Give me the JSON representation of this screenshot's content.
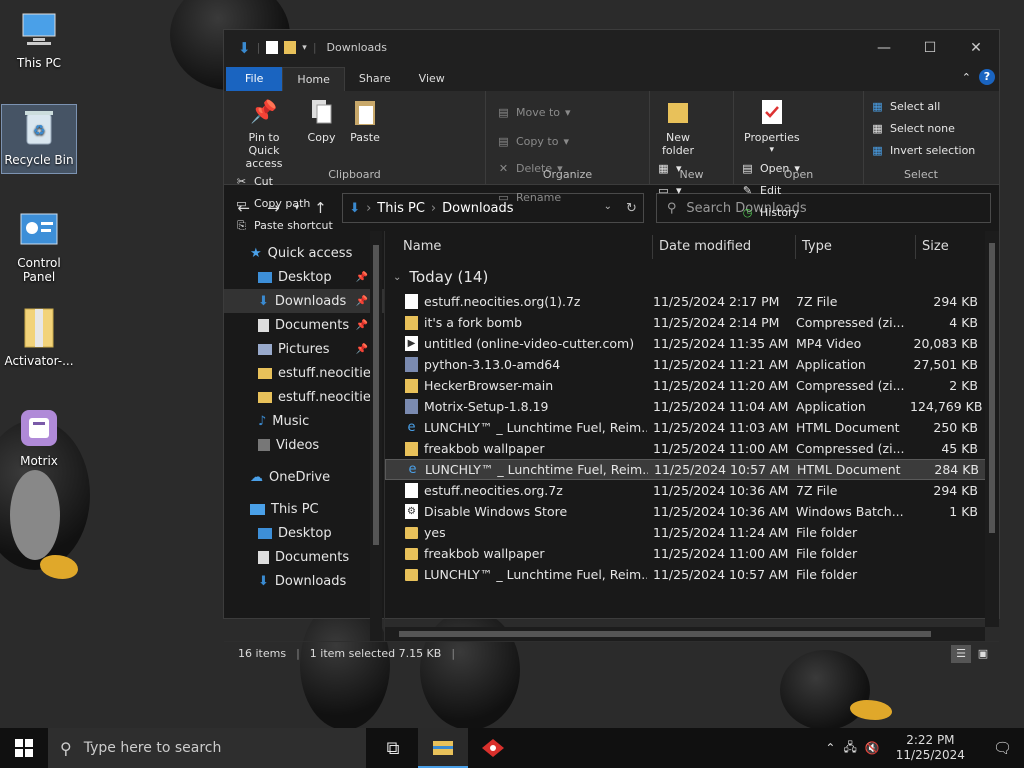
{
  "desktop": {
    "icons": [
      {
        "label": "This PC"
      },
      {
        "label": "Recycle Bin"
      },
      {
        "label": "Control Panel"
      },
      {
        "label": "Activator-..."
      },
      {
        "label": "Motrix"
      }
    ]
  },
  "window": {
    "title": "Downloads",
    "tabs": {
      "file": "File",
      "home": "Home",
      "share": "Share",
      "view": "View"
    },
    "help": "?"
  },
  "ribbon": {
    "clipboard": {
      "name": "Clipboard",
      "pin": "Pin to Quick access",
      "copy": "Copy",
      "paste": "Paste",
      "cut": "Cut",
      "copy_path": "Copy path",
      "paste_shortcut": "Paste shortcut"
    },
    "organize": {
      "name": "Organize",
      "move_to": "Move to",
      "copy_to": "Copy to",
      "delete": "Delete",
      "rename": "Rename"
    },
    "new": {
      "name": "New",
      "new_folder": "New folder"
    },
    "open": {
      "name": "Open",
      "properties": "Properties",
      "open": "Open",
      "edit": "Edit",
      "history": "History"
    },
    "select": {
      "name": "Select",
      "select_all": "Select all",
      "select_none": "Select none",
      "invert": "Invert selection"
    }
  },
  "address": {
    "crumbs": [
      "This PC",
      "Downloads"
    ],
    "search_placeholder": "Search Downloads"
  },
  "nav": {
    "quick_access": "Quick access",
    "items": [
      {
        "label": "Desktop",
        "pinned": true
      },
      {
        "label": "Downloads",
        "pinned": true
      },
      {
        "label": "Documents",
        "pinned": true
      },
      {
        "label": "Pictures",
        "pinned": true
      },
      {
        "label": "estuff.neocities",
        "pinned": false
      },
      {
        "label": "estuff.neocities",
        "pinned": false
      },
      {
        "label": "Music",
        "pinned": false
      },
      {
        "label": "Videos",
        "pinned": false
      }
    ],
    "onedrive": "OneDrive",
    "this_pc": "This PC",
    "pc_items": [
      {
        "label": "Desktop"
      },
      {
        "label": "Documents"
      },
      {
        "label": "Downloads"
      }
    ]
  },
  "columns": {
    "name": "Name",
    "date": "Date modified",
    "type": "Type",
    "size": "Size"
  },
  "group": {
    "label": "Today (14)"
  },
  "files": [
    {
      "name": "estuff.neocities.org(1).7z",
      "date": "11/25/2024 2:17 PM",
      "type": "7Z File",
      "size": "294 KB",
      "icon": "doc"
    },
    {
      "name": "it's a fork bomb",
      "date": "11/25/2024 2:14 PM",
      "type": "Compressed (zi...",
      "size": "4 KB",
      "icon": "zip"
    },
    {
      "name": "untitled (online-video-cutter.com)",
      "date": "11/25/2024 11:35 AM",
      "type": "MP4 Video",
      "size": "20,083 KB",
      "icon": "video"
    },
    {
      "name": "python-3.13.0-amd64",
      "date": "11/25/2024 11:21 AM",
      "type": "Application",
      "size": "27,501 KB",
      "icon": "app"
    },
    {
      "name": "HeckerBrowser-main",
      "date": "11/25/2024 11:20 AM",
      "type": "Compressed (zi...",
      "size": "2 KB",
      "icon": "zip"
    },
    {
      "name": "Motrix-Setup-1.8.19",
      "date": "11/25/2024 11:04 AM",
      "type": "Application",
      "size": "124,769 KB",
      "icon": "app"
    },
    {
      "name": "LUNCHLY™ _ Lunchtime Fuel, Reim...",
      "date": "11/25/2024 11:03 AM",
      "type": "HTML Document",
      "size": "250 KB",
      "icon": "html"
    },
    {
      "name": "freakbob wallpaper",
      "date": "11/25/2024 11:00 AM",
      "type": "Compressed (zi...",
      "size": "45 KB",
      "icon": "zip"
    },
    {
      "name": "LUNCHLY™ _ Lunchtime Fuel, Reim...",
      "date": "11/25/2024 10:57 AM",
      "type": "HTML Document",
      "size": "284 KB",
      "icon": "html",
      "selected": true
    },
    {
      "name": "estuff.neocities.org.7z",
      "date": "11/25/2024 10:36 AM",
      "type": "7Z File",
      "size": "294 KB",
      "icon": "doc"
    },
    {
      "name": "Disable Windows Store",
      "date": "11/25/2024 10:36 AM",
      "type": "Windows Batch...",
      "size": "1 KB",
      "icon": "batch"
    },
    {
      "name": "yes",
      "date": "11/25/2024 11:24 AM",
      "type": "File folder",
      "size": "",
      "icon": "folder"
    },
    {
      "name": "freakbob wallpaper",
      "date": "11/25/2024 11:00 AM",
      "type": "File folder",
      "size": "",
      "icon": "folder"
    },
    {
      "name": "LUNCHLY™ _ Lunchtime Fuel, Reim...",
      "date": "11/25/2024 10:57 AM",
      "type": "File folder",
      "size": "",
      "icon": "folder"
    }
  ],
  "status": {
    "count": "16 items",
    "selected": "1 item selected  7.15 KB"
  },
  "taskbar": {
    "search_placeholder": "Type here to search",
    "time": "2:22 PM",
    "date": "11/25/2024"
  }
}
